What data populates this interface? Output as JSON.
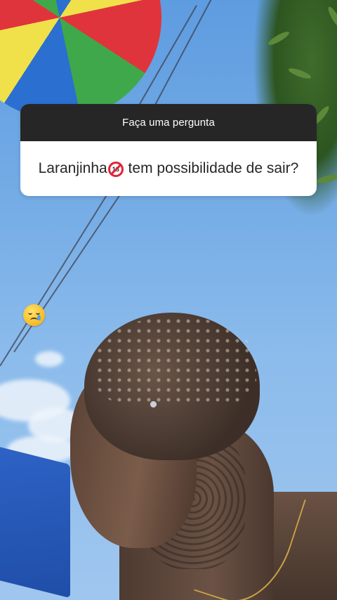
{
  "story": {
    "question_sticker": {
      "header": "Faça uma pergunta",
      "question_before_icon": "Laranjinha",
      "question_icon_text": "18",
      "question_after_icon": " tem possibilidade de sair?"
    },
    "emoji_sticker": "smiling-face-with-tear-icon",
    "colors": {
      "header_bg": "#262626",
      "card_bg": "#ffffff",
      "text": "#262626",
      "prohibited_red": "#e0243b"
    }
  }
}
